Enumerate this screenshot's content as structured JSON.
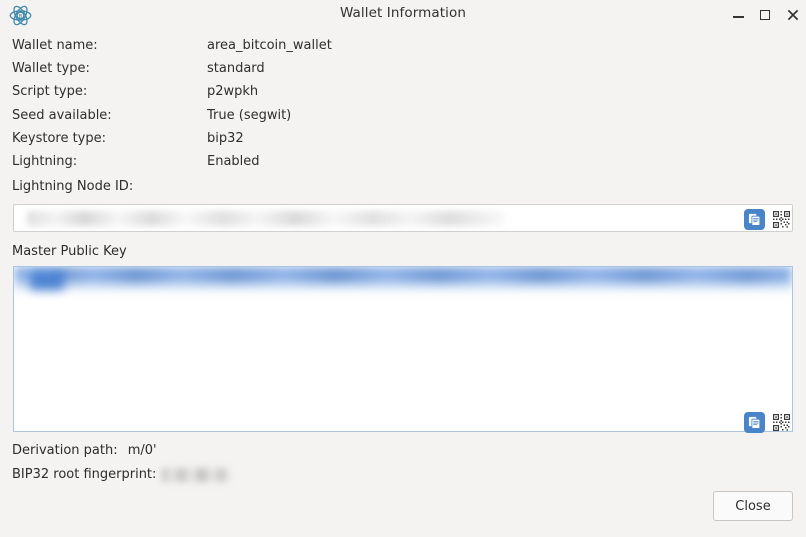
{
  "window": {
    "title": "Wallet Information",
    "logo_icon": "electrum-logo-icon",
    "minimize_label": "Minimize",
    "maximize_label": "Maximize",
    "close_label": "Close window"
  },
  "info": {
    "rows": [
      {
        "label": "Wallet name:",
        "value": "area_bitcoin_wallet"
      },
      {
        "label": "Wallet type:",
        "value": "standard"
      },
      {
        "label": "Script type:",
        "value": "p2wpkh"
      },
      {
        "label": "Seed available:",
        "value": "True (segwit)"
      },
      {
        "label": "Keystore type:",
        "value": "bip32"
      },
      {
        "label": "Lightning:",
        "value": "Enabled"
      }
    ]
  },
  "lightning_node": {
    "label": "Lightning Node ID:",
    "value": "",
    "placeholder": "",
    "copy_icon": "copy-icon",
    "qr_icon": "qr-code-icon"
  },
  "master_public_key": {
    "label": "Master Public Key",
    "value": "",
    "copy_icon": "copy-icon",
    "qr_icon": "qr-code-icon"
  },
  "derivation": {
    "label": "Derivation path:",
    "value": "m/0'"
  },
  "fingerprint": {
    "label": "BIP32 root fingerprint:",
    "value": ""
  },
  "footer": {
    "close_label": "Close"
  },
  "colors": {
    "background": "#f4f3f1",
    "accent_blue": "#4a84c8",
    "selection_blue": "#74a0e2",
    "field_border": "#cfcfcd",
    "textarea_border": "#a9c5e2",
    "text": "#2e2e2e"
  }
}
